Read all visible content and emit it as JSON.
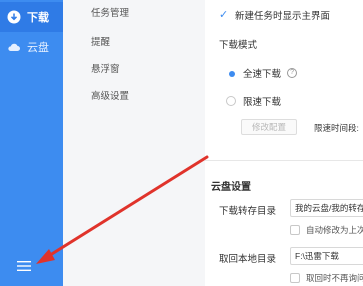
{
  "sidebar": {
    "items": [
      {
        "label": "下载",
        "icon": "download-icon"
      },
      {
        "label": "云盘",
        "icon": "cloud-icon"
      }
    ],
    "menu_icon": "menu-icon"
  },
  "nav": {
    "items": [
      "任务管理",
      "提醒",
      "悬浮窗",
      "高级设置"
    ]
  },
  "settings": {
    "show_main_on_new_task": "新建任务时显示主界面",
    "download_mode_title": "下载模式",
    "full_speed": "全速下载",
    "limited_speed": "限速下载",
    "modify_config": "修改配置",
    "limit_period": "限速时间段:",
    "cloud_section_title": "云盘设置",
    "transfer_dir_label": "下载转存目录",
    "transfer_dir_value": "我的云盘/我的转存",
    "auto_modify": "自动修改为上次",
    "local_dir_label": "取回本地目录",
    "local_dir_value": "F:\\迅雷下载",
    "no_ask": "取回时不再询问"
  },
  "colors": {
    "sidebar_bg": "#3d8cf0",
    "accent": "#3d8cf0",
    "annotation_arrow": "#e0332b"
  }
}
